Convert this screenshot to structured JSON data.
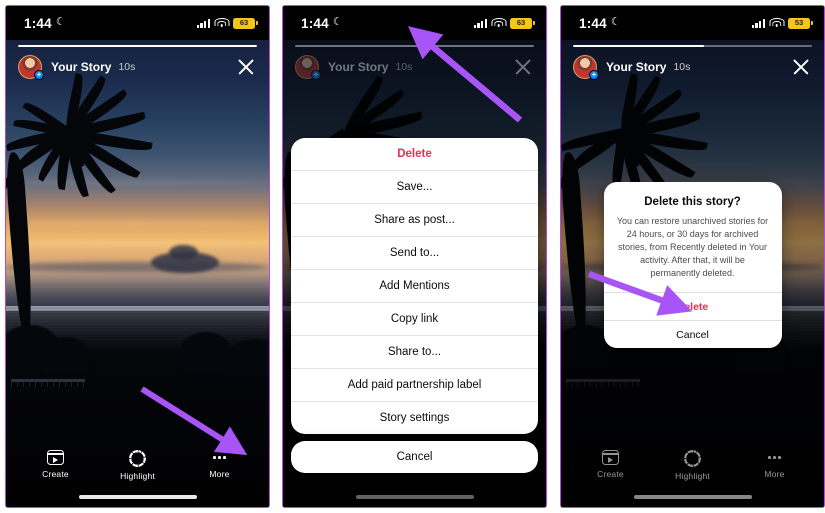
{
  "panels": [
    {
      "id": "story-view",
      "status": {
        "time": "1:44",
        "battery": "63",
        "moon_icon": "crescent-moon-icon"
      },
      "story": {
        "username": "Your Story",
        "elapsed": "10s",
        "progress_percent": 100
      },
      "toolbar": [
        {
          "icon": "create-icon",
          "label": "Create"
        },
        {
          "icon": "highlight-icon",
          "label": "Highlight"
        },
        {
          "icon": "more-icon",
          "label": "More"
        }
      ]
    },
    {
      "id": "more-menu",
      "status": {
        "time": "1:44",
        "battery": "63",
        "moon_icon": "crescent-moon-icon"
      },
      "story": {
        "username": "Your Story",
        "elapsed": "10s",
        "progress_percent": 100
      },
      "menu_items": [
        {
          "label": "Delete",
          "style": "danger"
        },
        {
          "label": "Save...",
          "style": "normal"
        },
        {
          "label": "Share as post...",
          "style": "normal"
        },
        {
          "label": "Send to...",
          "style": "normal"
        },
        {
          "label": "Add Mentions",
          "style": "normal"
        },
        {
          "label": "Copy link",
          "style": "normal"
        },
        {
          "label": "Share to...",
          "style": "normal"
        },
        {
          "label": "Add paid partnership label",
          "style": "normal"
        },
        {
          "label": "Story settings",
          "style": "normal"
        }
      ],
      "cancel_label": "Cancel"
    },
    {
      "id": "delete-confirm",
      "status": {
        "time": "1:44",
        "battery": "53",
        "moon_icon": "crescent-moon-icon"
      },
      "story": {
        "username": "Your Story",
        "elapsed": "10s",
        "progress_percent": 55
      },
      "dialog": {
        "title": "Delete this story?",
        "message": "You can restore unarchived stories for 24 hours, or 30 days for archived stories, from Recently deleted in Your activity. After that, it will be permanently deleted.",
        "confirm_label": "Delete",
        "cancel_label": "Cancel"
      },
      "toolbar": [
        {
          "icon": "create-icon",
          "label": "Create"
        },
        {
          "icon": "highlight-icon",
          "label": "Highlight"
        },
        {
          "icon": "more-icon",
          "label": "More"
        }
      ]
    }
  ],
  "annotations": {
    "arrow_color": "#a855f7",
    "arrows": [
      {
        "name": "arrow-to-more-button",
        "panel": 1
      },
      {
        "name": "arrow-to-delete-menu-item",
        "panel": 2
      },
      {
        "name": "arrow-to-delete-confirm-button",
        "panel": 3
      }
    ]
  }
}
